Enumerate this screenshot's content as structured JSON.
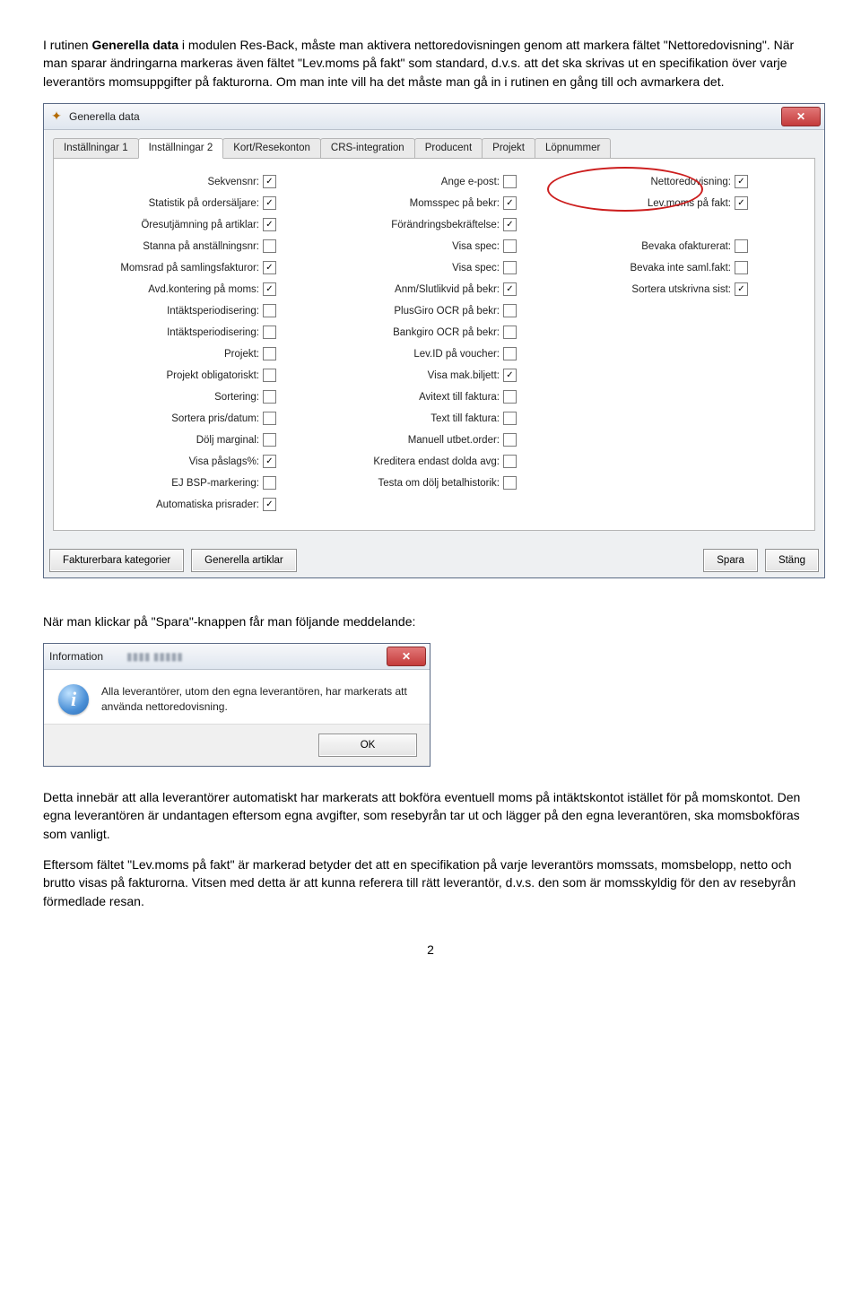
{
  "doc": {
    "p1_a": "I rutinen ",
    "p1_b": "Generella data",
    "p1_c": " i modulen Res-Back, måste man aktivera nettoredovisningen genom att markera fältet \"Nettoredovisning\". När man sparar ändringarna markeras även fältet \"Lev.moms på fakt\" som standard, d.v.s. att det ska skrivas ut en specifikation över varje leverantörs momsuppgifter på fakturorna. Om man inte vill ha det måste man gå in i rutinen en gång till och avmarkera det.",
    "p2": "När man klickar på \"Spara\"-knappen får man följande meddelande:",
    "p3": "Detta innebär att alla leverantörer automatiskt har markerats att bokföra eventuell moms på intäktskontot istället för på momskontot. Den egna leverantören är undantagen eftersom egna avgifter, som resebyrån tar ut och lägger på den egna leverantören, ska momsbokföras som vanligt.",
    "p4": "Eftersom fältet \"Lev.moms på fakt\" är markerad betyder det att en specifikation på varje leverantörs momssats, momsbelopp, netto och brutto visas på fakturorna. Vitsen med detta är att kunna referera till rätt leverantör, d.v.s. den som är momsskyldig för den av resebyrån förmedlade resan.",
    "page": "2"
  },
  "win": {
    "title": "Generella data",
    "close": "✕",
    "tabs": [
      "Inställningar 1",
      "Inställningar 2",
      "Kort/Resekonton",
      "CRS-integration",
      "Producent",
      "Projekt",
      "Löpnummer"
    ],
    "col1": [
      {
        "label": "Sekvensnr:",
        "checked": true
      },
      {
        "label": "Statistik på ordersäljare:",
        "checked": true
      },
      {
        "label": "Öresutjämning på artiklar:",
        "checked": true
      },
      {
        "label": "Stanna på anställningsnr:",
        "checked": false
      },
      {
        "label": "Momsrad på samlingsfakturor:",
        "checked": true
      },
      {
        "label": "Avd.kontering på moms:",
        "checked": true
      },
      {
        "label": "Intäktsperiodisering:",
        "checked": false
      },
      {
        "label": "Intäktsperiodisering:",
        "checked": false
      },
      {
        "label": "Projekt:",
        "checked": false
      },
      {
        "label": "Projekt obligatoriskt:",
        "checked": false
      },
      {
        "label": "Sortering:",
        "checked": false
      },
      {
        "label": "Sortera pris/datum:",
        "checked": false
      },
      {
        "label": "Dölj marginal:",
        "checked": false
      },
      {
        "label": "Visa påslags%:",
        "checked": true
      },
      {
        "label": "EJ BSP-markering:",
        "checked": false
      },
      {
        "label": "Automatiska prisrader:",
        "checked": true
      }
    ],
    "col2": [
      {
        "label": "Ange e-post:",
        "checked": false
      },
      {
        "label": "Momsspec på bekr:",
        "checked": true
      },
      {
        "label": "Förändringsbekräftelse:",
        "checked": true
      },
      {
        "label": "Visa spec:",
        "checked": false
      },
      {
        "label": "Visa spec:",
        "checked": false
      },
      {
        "label": "Anm/Slutlikvid på bekr:",
        "checked": true
      },
      {
        "label": "PlusGiro OCR på bekr:",
        "checked": false
      },
      {
        "label": "Bankgiro OCR på bekr:",
        "checked": false
      },
      {
        "label": "Lev.ID på voucher:",
        "checked": false
      },
      {
        "label": "Visa mak.biljett:",
        "checked": true
      },
      {
        "label": "Avitext till faktura:",
        "checked": false
      },
      {
        "label": "Text till faktura:",
        "checked": false
      },
      {
        "label": "Manuell utbet.order:",
        "checked": false
      },
      {
        "label": "Kreditera endast dolda avg:",
        "checked": false
      },
      {
        "label": "Testa om dölj betalhistorik:",
        "checked": false
      }
    ],
    "col3": [
      {
        "label": "Nettoredovisning:",
        "checked": true
      },
      {
        "label": "Lev.moms på fakt:",
        "checked": true
      },
      {
        "label": "",
        "spacer": true
      },
      {
        "label": "Bevaka ofakturerat:",
        "checked": false
      },
      {
        "label": "Bevaka inte saml.fakt:",
        "checked": false
      },
      {
        "label": "Sortera utskrivna sist:",
        "checked": true
      }
    ],
    "buttons": {
      "b1": "Fakturerbara kategorier",
      "b2": "Generella artiklar",
      "b3": "Spara",
      "b4": "Stäng"
    }
  },
  "dlg": {
    "title": "Information",
    "msg": "Alla leverantörer, utom den egna leverantören, har markerats att använda nettoredovisning.",
    "ok": "OK"
  }
}
